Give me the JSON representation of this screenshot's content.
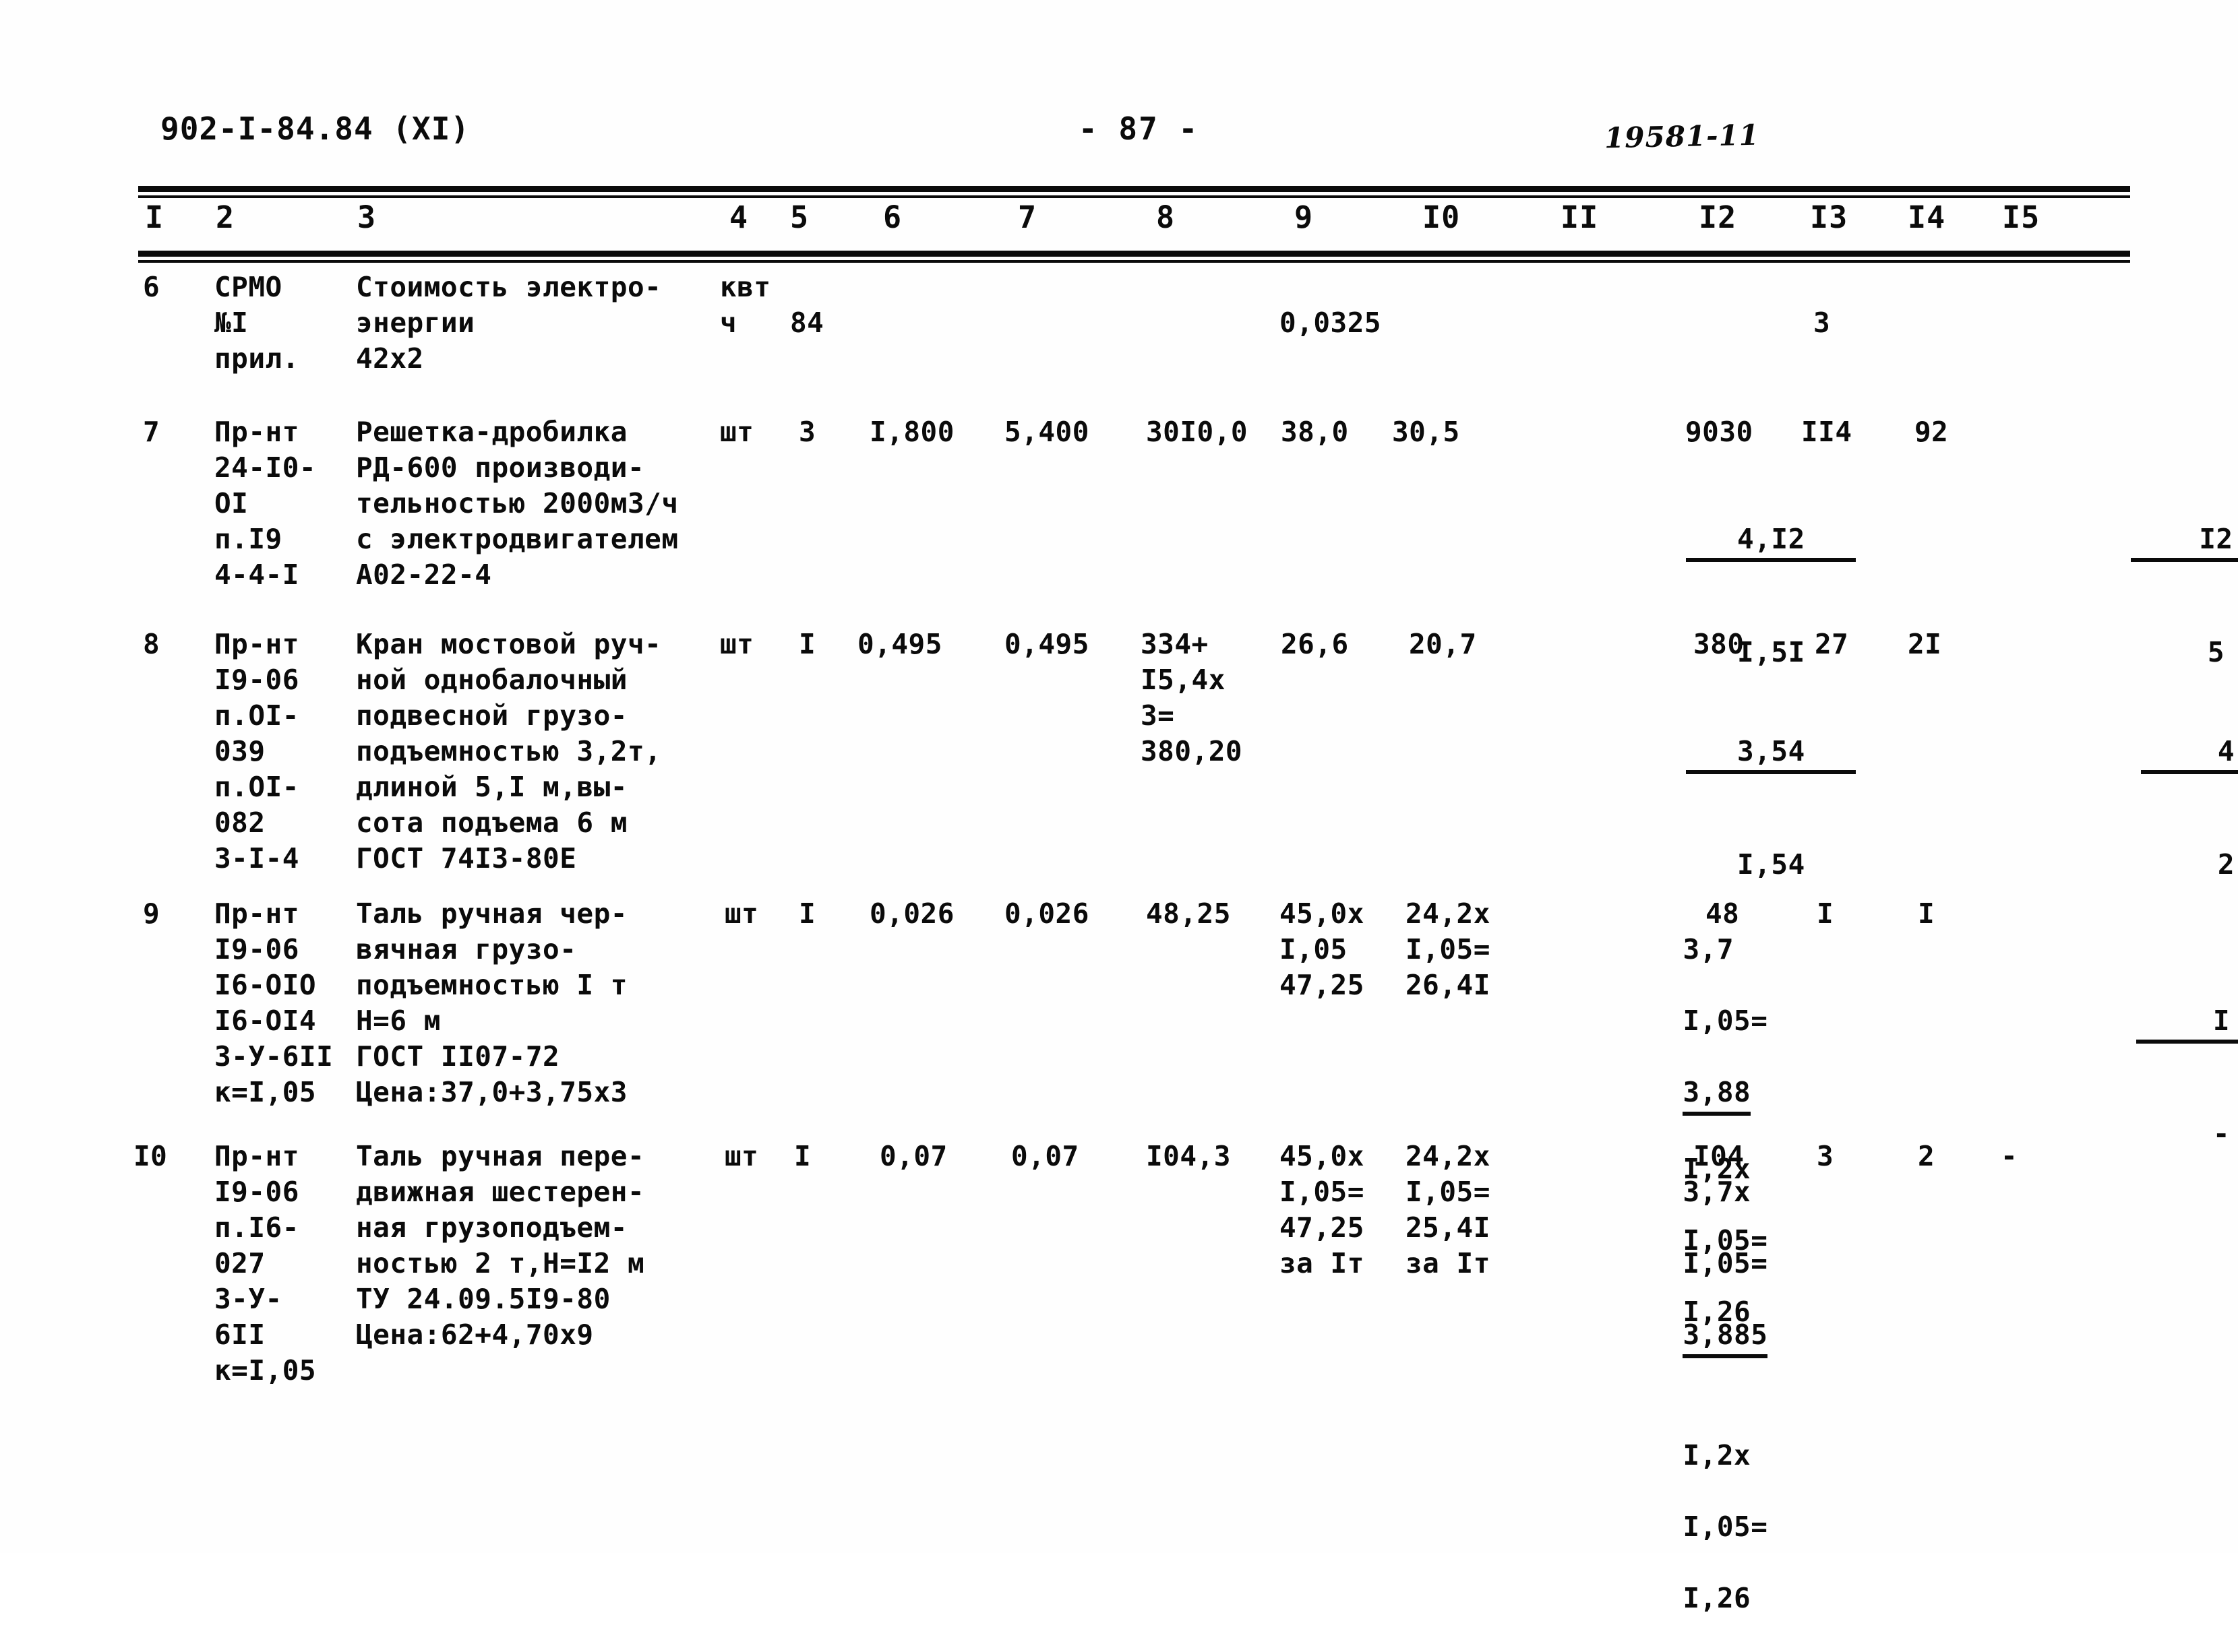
{
  "header": {
    "doc_code": "902-I-84.84 (XI)",
    "page_number": "- 87 -",
    "handwritten_stamp": "19581-11"
  },
  "table": {
    "column_headers": [
      "I",
      "2",
      "3",
      "4",
      "5",
      "6",
      "7",
      "8",
      "9",
      "I0",
      "II",
      "I2",
      "I3",
      "I4",
      "I5"
    ],
    "rows": [
      {
        "c1": "6",
        "c2": "СРМО\n№I\nприл.",
        "c3": "Стоимость электро-\nэнергии\n42х2",
        "c4": "квт\nч",
        "c5": "84",
        "c6": "",
        "c7": "",
        "c8": "",
        "c9": "0,0325",
        "c10": "",
        "c11": "",
        "c12": "",
        "c13": "3",
        "c14": "",
        "c15": ""
      },
      {
        "c1": "7",
        "c2": "Пр-нт\n24-I0-\nOI\nп.I9\n4-4-I",
        "c3": "Решетка-дробилка\nРД-600 производи-\nтельностью 2000м3/ч\nс электродвигателем\nА02-22-4",
        "c4": "шт",
        "c5": "3",
        "c6": "I,800",
        "c7": "5,400",
        "c8": "30I0,0",
        "c9": "38,0",
        "c10": "30,5",
        "c11_frac_top": "4,I2",
        "c11_frac_bottom": "I,5I",
        "c12": "9030",
        "c13": "II4",
        "c14": "92",
        "c15_frac_top": "I2",
        "c15_frac_bottom": "5"
      },
      {
        "c1": "8",
        "c2": "Пр-нт\nI9-06\nп.OI-\n039\nп.OI-\n082\n3-I-4",
        "c3": "Кран мостовой руч-\nной однобалочный\nподвесной грузо-\nподъемностью 3,2т,\nдлиной 5,I м,вы-\nсота подъема 6 м\nГОСТ 74I3-80Е",
        "c4": "шт",
        "c5": "I",
        "c6": "0,495",
        "c7": "0,495",
        "c8": "334+\nI5,4х\n3=\n380,20",
        "c9": "26,6",
        "c10": "20,7",
        "c11_frac_top": "3,54",
        "c11_frac_bottom": "I,54",
        "c12": "380",
        "c13": "27",
        "c14": "2I",
        "c15_frac_top": "4",
        "c15_frac_bottom": "2"
      },
      {
        "c1": "9",
        "c2": "Пр-нт\nI9-06\nI6-OIO\nI6-OI4\n3-У-6II\nк=I,05",
        "c3": "Таль ручная чер-\nвячная грузо-\nподъемностью I т\nН=6 м\nГОСТ II07-72\nЦена:37,0+3,75х3",
        "c4": "шт",
        "c5": "I",
        "c6": "0,026",
        "c7": "0,026",
        "c8": "48,25",
        "c9": "45,0х\nI,05\n47,25",
        "c10": "24,2х\nI,05=\n26,4I",
        "c11_line1": "3,7",
        "c11_line2": "I,05=",
        "c11_line3": "3,88",
        "c11_line4": "I,2х",
        "c11_line5": "I,05=",
        "c11_line6": "I,26",
        "c12": "48",
        "c13": "I",
        "c14": "I",
        "c15_frac_top": "I",
        "c15_frac_bottom": "-"
      },
      {
        "c1": "I0",
        "c2": "Пр-нт\nI9-06\nп.I6-\n027\n3-У-\n6II\nк=I,05",
        "c3": "Таль ручная пере-\nдвижная шестерен-\nная грузоподъем-\nностью 2 т,Н=I2 м\nТУ 24.09.5I9-80\nЦена:62+4,70х9",
        "c4": "шт",
        "c5": "I",
        "c6": "0,07",
        "c7": "0,07",
        "c8": "I04,3",
        "c9": "45,0х\nI,05=\n47,25\nза Iт",
        "c10": "24,2х\nI,05=\n25,4I\nза Iт",
        "c11_line1": "3,7х",
        "c11_line2": "I,05=",
        "c11_line3": "3,885",
        "c11_line4": "I,2х",
        "c11_line5": "I,05=",
        "c11_line6": "I,26",
        "c12": "I04",
        "c13": "3",
        "c14": "2",
        "c15": "-"
      }
    ]
  }
}
